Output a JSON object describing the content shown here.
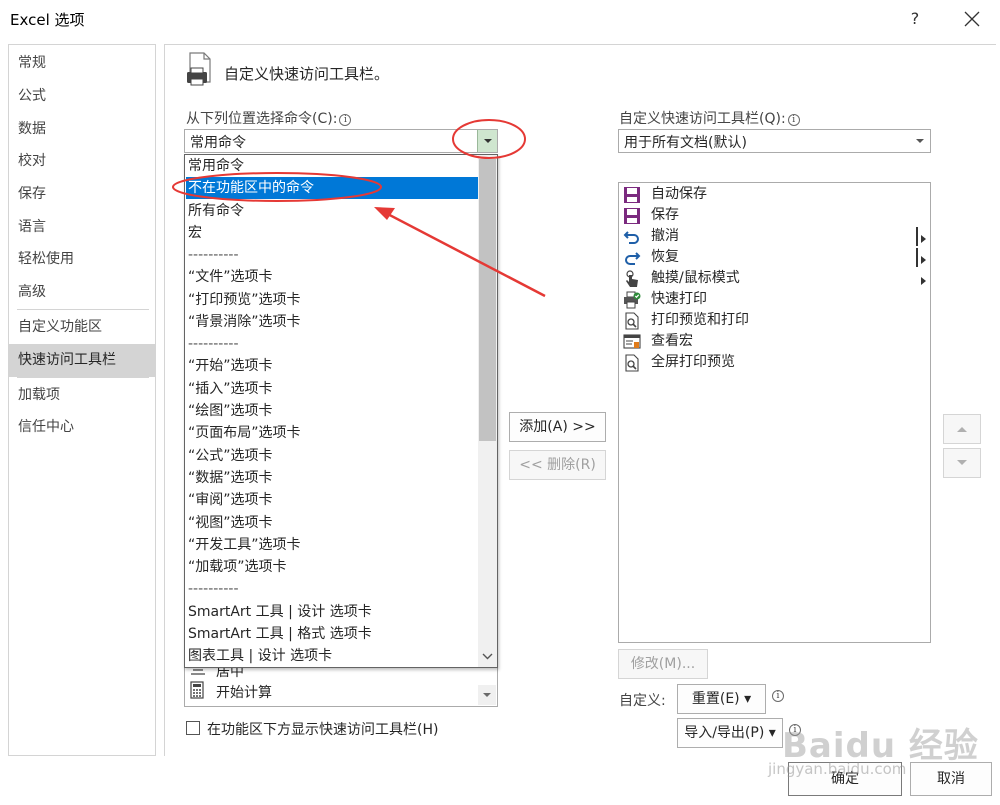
{
  "window": {
    "title": "Excel 选项",
    "help_label": "?"
  },
  "nav": {
    "items": [
      {
        "label": "常规"
      },
      {
        "label": "公式"
      },
      {
        "label": "数据"
      },
      {
        "label": "校对"
      },
      {
        "label": "保存"
      },
      {
        "label": "语言"
      },
      {
        "label": "轻松使用"
      },
      {
        "label": "高级"
      },
      {
        "label": "自定义功能区"
      },
      {
        "label": "快速访问工具栏",
        "selected": true
      },
      {
        "label": "加载项"
      },
      {
        "label": "信任中心"
      }
    ]
  },
  "main": {
    "heading": "自定义快速访问工具栏。",
    "choose_label": "从下列位置选择命令(C):",
    "choose_value": "常用命令",
    "dropdown_options": [
      "常用命令",
      "不在功能区中的命令",
      "所有命令",
      "宏",
      "----------",
      "“文件”选项卡",
      "“打印预览”选项卡",
      "“背景消除”选项卡",
      "----------",
      "“开始”选项卡",
      "“插入”选项卡",
      "“绘图”选项卡",
      "“页面布局”选项卡",
      "“公式”选项卡",
      "“数据”选项卡",
      "“审阅”选项卡",
      "“视图”选项卡",
      "“开发工具”选项卡",
      "“加载项”选项卡",
      "----------",
      "SmartArt 工具 | 设计 选项卡",
      "SmartArt 工具 | 格式 选项卡",
      "图表工具 | 设计 选项卡"
    ],
    "dropdown_highlighted": "不在功能区中的命令",
    "behind_list_items": [
      "居中",
      "开始计算"
    ],
    "show_below_label": "在功能区下方显示快速访问工具栏(H)",
    "show_below_checked": false,
    "add_button": "添加(A) >>",
    "remove_button": "<< 删除(R)",
    "customize_label": "自定义快速访问工具栏(Q):",
    "customize_value": "用于所有文档(默认)",
    "qa_items": [
      {
        "label": "自动保存",
        "icon": "floppy-icon"
      },
      {
        "label": "保存",
        "icon": "floppy-icon"
      },
      {
        "label": "撤消",
        "icon": "undo-icon",
        "submenu": true
      },
      {
        "label": "恢复",
        "icon": "redo-icon",
        "submenu": true
      },
      {
        "label": "触摸/鼠标模式",
        "icon": "touch-icon",
        "submenu": true
      },
      {
        "label": "快速打印",
        "icon": "quick-print-icon"
      },
      {
        "label": "打印预览和打印",
        "icon": "print-preview-icon"
      },
      {
        "label": "查看宏",
        "icon": "macro-icon"
      },
      {
        "label": "全屏打印预览",
        "icon": "fullscreen-preview-icon"
      }
    ],
    "modify_button": "修改(M)...",
    "customizations_label": "自定义:",
    "reset_button": "重置(E) ▾",
    "import_export_button": "导入/导出(P) ▾"
  },
  "footer": {
    "ok": "确定",
    "cancel": "取消"
  },
  "watermark": {
    "brand": "Baidu 经验",
    "url": "jingyan.baidu.com"
  },
  "colors": {
    "highlight": "#0078d7",
    "annotation": "#e53935"
  }
}
